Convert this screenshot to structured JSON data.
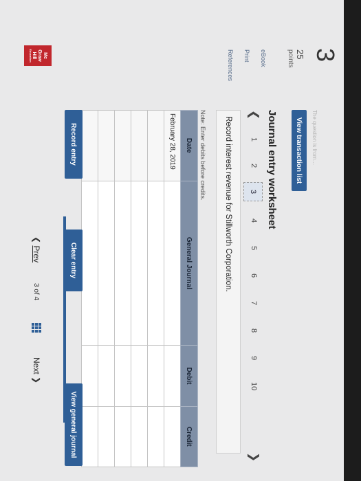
{
  "question": {
    "number": "3",
    "points_value": "25",
    "points_label": "points"
  },
  "side_links": [
    "eBook",
    "Print",
    "References"
  ],
  "faded_header": "The question is from…",
  "buttons": {
    "view_transaction_list": "View transaction list",
    "record_entry": "Record entry",
    "clear_entry": "Clear entry",
    "view_general_journal": "View general journal"
  },
  "worksheet": {
    "title": "Journal entry worksheet",
    "steps": [
      "1",
      "2",
      "3",
      "4",
      "5",
      "6",
      "7",
      "8",
      "9",
      "10"
    ],
    "current_step": "3",
    "description": "Record interest revenue for Stillworth Corporation.",
    "note": "Note: Enter debits before credits."
  },
  "table": {
    "headers": [
      "Date",
      "General Journal",
      "Debit",
      "Credit"
    ],
    "rows": [
      [
        "February 28, 2019",
        "",
        "",
        ""
      ],
      [
        "",
        "",
        "",
        ""
      ],
      [
        "",
        "",
        "",
        ""
      ],
      [
        "",
        "",
        "",
        ""
      ],
      [
        "",
        "",
        "",
        ""
      ],
      [
        "",
        "",
        "",
        ""
      ]
    ]
  },
  "pager": {
    "prev": "Prev",
    "position": "3 of 4",
    "next": "Next"
  },
  "logo": {
    "line1": "Mc",
    "line2": "Graw",
    "line3": "Hill",
    "line4": "Education"
  },
  "colors": {
    "accent": "#2f5f97",
    "header_bg": "#7f8fa6",
    "logo": "#c1272d"
  }
}
